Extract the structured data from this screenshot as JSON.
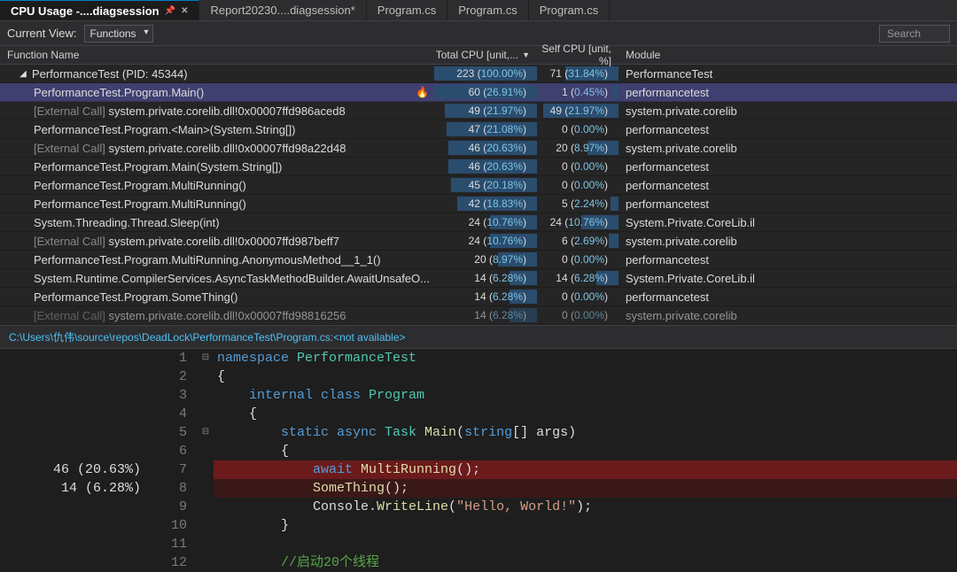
{
  "tabs": [
    {
      "label": "CPU Usage -....diagsession",
      "active": true,
      "pinned": true,
      "close": true
    },
    {
      "label": "Report20230....diagsession*"
    },
    {
      "label": "Program.cs"
    },
    {
      "label": "Program.cs"
    },
    {
      "label": "Program.cs"
    }
  ],
  "toolbar": {
    "current_view_label": "Current View:",
    "view_value": "Functions",
    "search_placeholder": "Search"
  },
  "columns": {
    "name": "Function Name",
    "total": "Total CPU [unit,...",
    "self": "Self CPU [unit, %]",
    "module": "Module"
  },
  "rows": [
    {
      "level": 0,
      "expander": "▢",
      "name": "PerformanceTest (PID: 45344)",
      "total_v": 223,
      "total_p": 100.0,
      "self_v": 71,
      "self_p": 31.84,
      "module": "PerformanceTest",
      "sel": false,
      "tbar": 100,
      "sbar": 65
    },
    {
      "level": 1,
      "flame": true,
      "name": "PerformanceTest.Program.Main()",
      "total_v": 60,
      "total_p": 26.91,
      "self_v": 1,
      "self_p": 0.45,
      "module": "performancetest",
      "sel": true,
      "tbar": 100,
      "sbar": 6
    },
    {
      "level": 1,
      "name": "[External Call] system.private.corelib.dll!0x00007ffd986aced8",
      "total_v": 49,
      "total_p": 21.97,
      "self_v": 49,
      "self_p": 21.97,
      "module": "system.private.corelib",
      "tbar": 90,
      "sbar": 92
    },
    {
      "level": 1,
      "name": "PerformanceTest.Program.<Main>(System.String[])",
      "total_v": 47,
      "total_p": 21.08,
      "self_v": 0,
      "self_p": 0.0,
      "module": "performancetest",
      "tbar": 88,
      "sbar": 0
    },
    {
      "level": 1,
      "name": "[External Call] system.private.corelib.dll!0x00007ffd98a22d48",
      "total_v": 46,
      "total_p": 20.63,
      "self_v": 20,
      "self_p": 8.97,
      "module": "system.private.corelib",
      "tbar": 86,
      "sbar": 38
    },
    {
      "level": 1,
      "name": "PerformanceTest.Program.Main(System.String[])",
      "total_v": 46,
      "total_p": 20.63,
      "self_v": 0,
      "self_p": 0.0,
      "module": "performancetest",
      "tbar": 86,
      "sbar": 0
    },
    {
      "level": 1,
      "name": "PerformanceTest.Program.MultiRunning()",
      "total_v": 45,
      "total_p": 20.18,
      "self_v": 0,
      "self_p": 0.0,
      "module": "performancetest",
      "tbar": 84,
      "sbar": 0
    },
    {
      "level": 1,
      "name": "PerformanceTest.Program.MultiRunning()",
      "total_v": 42,
      "total_p": 18.83,
      "self_v": 5,
      "self_p": 2.24,
      "module": "performancetest",
      "tbar": 78,
      "sbar": 10
    },
    {
      "level": 1,
      "name": "System.Threading.Thread.Sleep(int)",
      "total_v": 24,
      "total_p": 10.76,
      "self_v": 24,
      "self_p": 10.76,
      "module": "System.Private.CoreLib.il",
      "tbar": 46,
      "sbar": 46
    },
    {
      "level": 1,
      "name": "[External Call] system.private.corelib.dll!0x00007ffd987beff7",
      "total_v": 24,
      "total_p": 10.76,
      "self_v": 6,
      "self_p": 2.69,
      "module": "system.private.corelib",
      "tbar": 46,
      "sbar": 12
    },
    {
      "level": 1,
      "name": "PerformanceTest.Program.MultiRunning.AnonymousMethod__1_1()",
      "total_v": 20,
      "total_p": 8.97,
      "self_v": 0,
      "self_p": 0.0,
      "module": "performancetest",
      "tbar": 38,
      "sbar": 0
    },
    {
      "level": 1,
      "name": "System.Runtime.CompilerServices.AsyncTaskMethodBuilder.AwaitUnsafeO...",
      "total_v": 14,
      "total_p": 6.28,
      "self_v": 14,
      "self_p": 6.28,
      "module": "System.Private.CoreLib.il",
      "tbar": 27,
      "sbar": 27
    },
    {
      "level": 1,
      "name": "PerformanceTest.Program.SomeThing()",
      "total_v": 14,
      "total_p": 6.28,
      "self_v": 0,
      "self_p": 0.0,
      "module": "performancetest",
      "tbar": 27,
      "sbar": 0
    },
    {
      "level": 1,
      "name": "[External Call] system.private.corelib.dll!0x00007ffd98816256",
      "total_v": 14,
      "total_p": 6.28,
      "self_v": 0,
      "self_p": 0.0,
      "module": "system.private.corelib",
      "tbar": 27,
      "sbar": 0,
      "cut": true
    }
  ],
  "path": "C:\\Users\\仇伟\\source\\repos\\DeadLock\\PerformanceTest\\Program.cs:<not available>",
  "metrics": {
    "l7": "46 (20.63%)",
    "l8": "14 (6.28%)"
  },
  "code": {
    "ns": "PerformanceTest",
    "cls": "Program",
    "l1": "namespace ",
    "l2": "{",
    "l3a": "    internal class ",
    "l4": "    {",
    "l5a": "        static async ",
    "l5b": "Task ",
    "l5c": "Main",
    "l5d": "(",
    "l5e": "string",
    "l5f": "[] args)",
    "l6": "        {",
    "l7a": "            await ",
    "l7b": "MultiRunning",
    "l7c": "();",
    "l8a": "            ",
    "l8b": "SomeThing",
    "l8c": "();",
    "l9a": "            Console.",
    "l9b": "WriteLine",
    "l9c": "(",
    "l9d": "\"Hello, World!\"",
    "l9e": ");",
    "l10": "        }",
    "l11": "",
    "l12": "        //启动20个线程"
  }
}
